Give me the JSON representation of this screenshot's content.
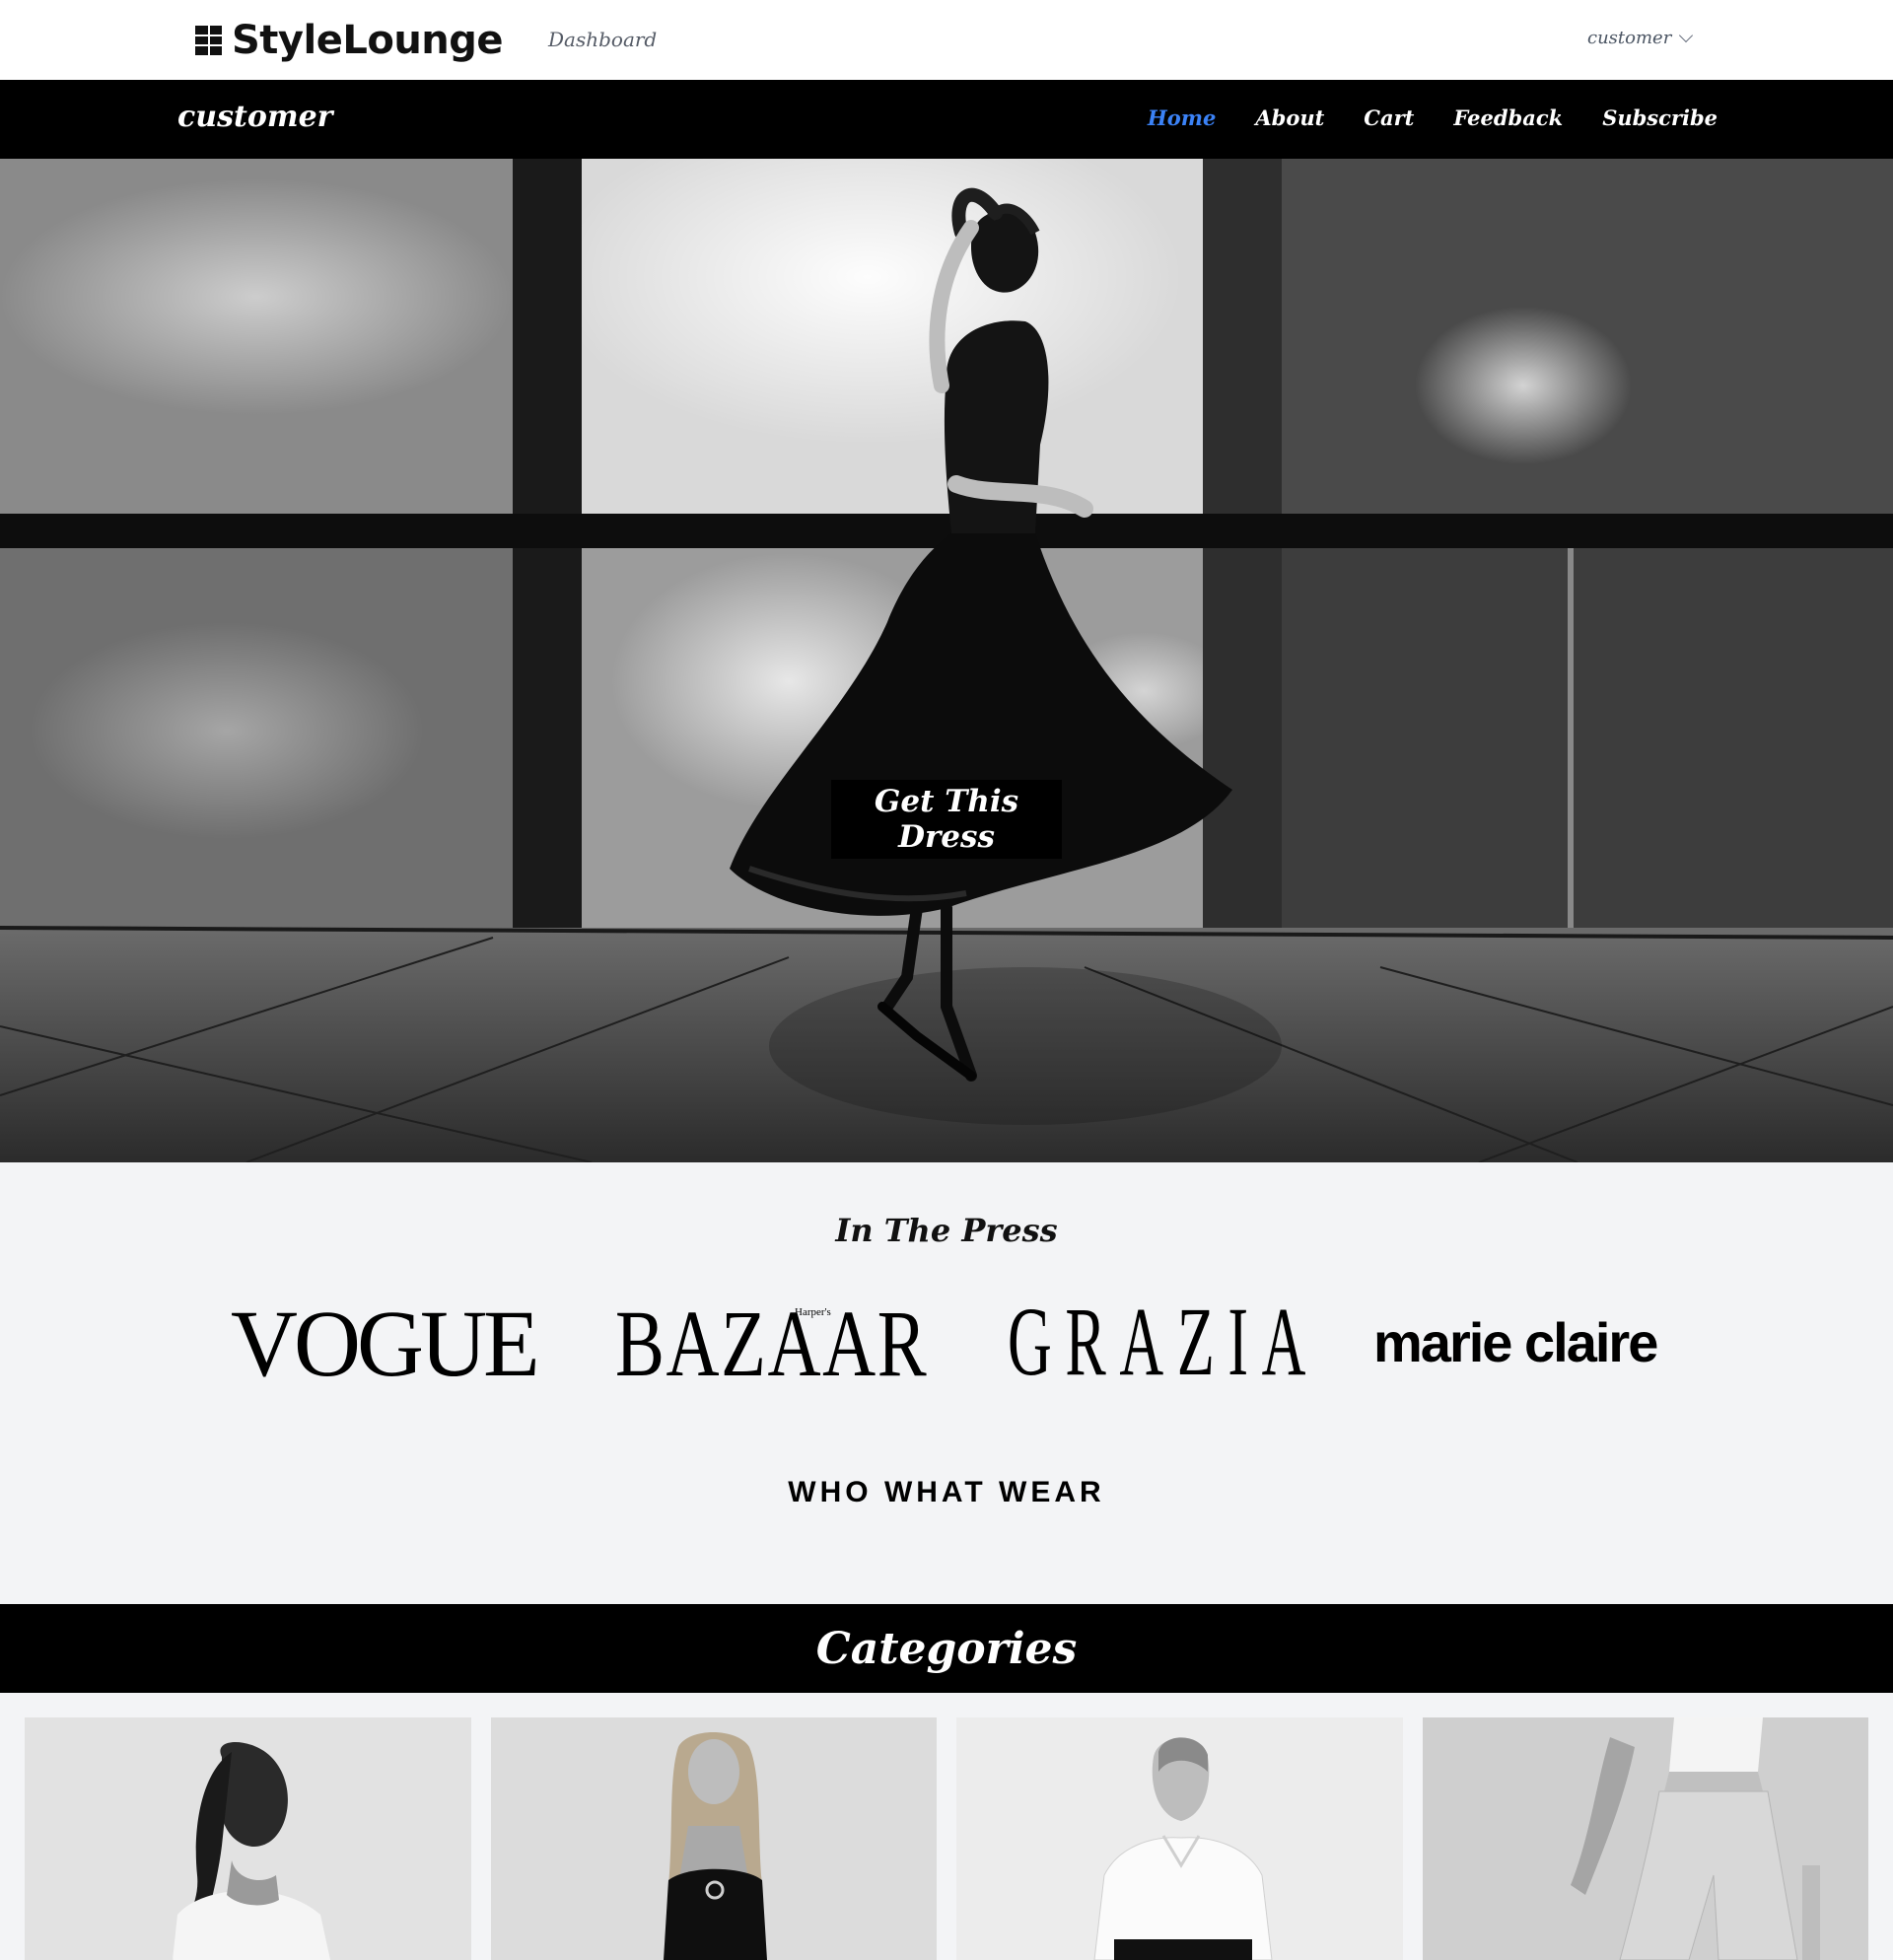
{
  "topbar": {
    "brand": "StyleLounge",
    "dashboard_link": "Dashboard",
    "user_menu": "customer"
  },
  "navbar": {
    "brand": "customer",
    "links": [
      "Home",
      "About",
      "Cart",
      "Feedback",
      "Subscribe"
    ],
    "active_link": "Home",
    "active_color": "#3b82f6"
  },
  "hero": {
    "cta_label": "Get This Dress"
  },
  "press": {
    "title": "In The Press",
    "logos": [
      "VOGUE",
      "BAZAAR",
      "GRAZIA",
      "marie claire",
      "WHO WHAT WEAR"
    ],
    "bazaar_prefix": "Harper's"
  },
  "categories": {
    "title": "Categories",
    "cards": [
      {
        "icon": "model-photo-tank-top"
      },
      {
        "icon": "model-photo-black-dress"
      },
      {
        "icon": "model-photo-white-shirt"
      },
      {
        "icon": "model-photo-trousers"
      }
    ]
  },
  "colors": {
    "nav_bg": "#000000",
    "page_bg": "#f3f4f6",
    "accent": "#3b82f6"
  }
}
